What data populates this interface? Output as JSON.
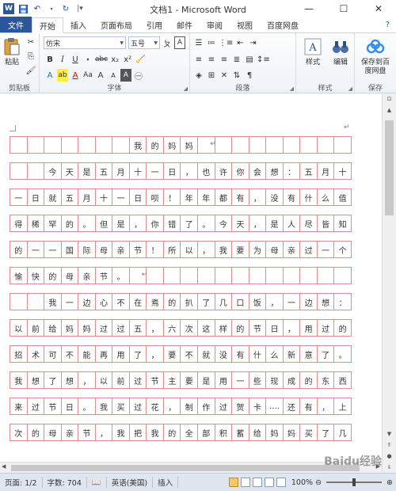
{
  "window": {
    "title": "文档1 - Microsoft Word",
    "controls": [
      "—",
      "☐",
      "✕"
    ]
  },
  "qat": {
    "undo": "↶",
    "redo": "↻"
  },
  "tabs": {
    "file": "文件",
    "items": [
      "开始",
      "插入",
      "页面布局",
      "引用",
      "邮件",
      "审阅",
      "视图",
      "百度网盘"
    ],
    "active": "开始",
    "help": "?"
  },
  "ribbon": {
    "clipboard": {
      "label": "剪贴板",
      "paste": "粘贴"
    },
    "font": {
      "label": "字体",
      "font_name": "仿宋",
      "font_size": "五号",
      "row1_buttons": [
        "A",
        "A",
        "Aa",
        "ab"
      ],
      "row2_buttons": [
        "B",
        "I",
        "U",
        "abc",
        "x₂",
        "x²"
      ],
      "row3_buttons": [
        "A",
        "A",
        "Aa",
        "A",
        "A"
      ]
    },
    "paragraph": {
      "label": "段落"
    },
    "styles": {
      "label": "样式",
      "button": "样式"
    },
    "editing": {
      "button": "编辑"
    },
    "save": {
      "label": "保存",
      "button_line1": "保存到百",
      "button_line2": "度网盘"
    }
  },
  "document": {
    "rows": [
      [
        "",
        "",
        "",
        "",
        "",
        "",
        "",
        "我",
        "的",
        "妈",
        "妈",
        "",
        "",
        "",
        "",
        "",
        "",
        "",
        "",
        ""
      ],
      [
        "",
        "",
        "今",
        "天",
        "是",
        "五",
        "月",
        "十",
        "一",
        "日",
        "，",
        "也",
        "许",
        "你",
        "会",
        "想",
        "：",
        "五",
        "月",
        "十"
      ],
      [
        "一",
        "日",
        "就",
        "五",
        "月",
        "十",
        "一",
        "日",
        "呗",
        "！",
        "年",
        "年",
        "都",
        "有",
        "，",
        "没",
        "有",
        "什",
        "么",
        "值"
      ],
      [
        "得",
        "稀",
        "罕",
        "的",
        "。",
        "但",
        "是",
        "，",
        "你",
        "错",
        "了",
        "。",
        "今",
        "天",
        "，",
        "是",
        "人",
        "尽",
        "皆",
        "知"
      ],
      [
        "的",
        "一",
        "一",
        "国",
        "际",
        "母",
        "亲",
        "节",
        "！",
        "所",
        "以",
        "，",
        "我",
        "要",
        "为",
        "母",
        "亲",
        "过",
        "一",
        "个"
      ],
      [
        "愉",
        "快",
        "的",
        "母",
        "亲",
        "节",
        "。",
        "",
        "",
        "",
        "",
        "",
        "",
        "",
        "",
        "",
        "",
        "",
        "",
        ""
      ],
      [
        "",
        "",
        "我",
        "一",
        "边",
        "心",
        "不",
        "在",
        "焉",
        "的",
        "扒",
        "了",
        "几",
        "口",
        "饭",
        "，",
        "一",
        "边",
        "想",
        "："
      ],
      [
        "以",
        "前",
        "给",
        "妈",
        "妈",
        "过",
        "过",
        "五",
        "，",
        "六",
        "次",
        "这",
        "样",
        "的",
        "节",
        "日",
        "，",
        "用",
        "过",
        "的"
      ],
      [
        "招",
        "术",
        "可",
        "不",
        "能",
        "再",
        "用",
        "了",
        "，",
        "要",
        "不",
        "就",
        "没",
        "有",
        "什",
        "么",
        "新",
        "意",
        "了",
        "。"
      ],
      [
        "我",
        "想",
        "了",
        "想",
        "，",
        "以",
        "前",
        "过",
        "节",
        "主",
        "要",
        "是",
        "用",
        "一",
        "些",
        "现",
        "成",
        "的",
        "东",
        "西"
      ],
      [
        "来",
        "过",
        "节",
        "日",
        "。",
        "我",
        "买",
        "过",
        "花",
        "，",
        "制",
        "作",
        "过",
        "贺",
        "卡",
        "….",
        "还",
        "有",
        "，",
        "上"
      ],
      [
        "次",
        "的",
        "母",
        "亲",
        "节",
        "，",
        "我",
        "把",
        "我",
        "的",
        "全",
        "部",
        "积",
        "蓄",
        "给",
        "妈",
        "妈",
        "买",
        "了",
        "几"
      ]
    ]
  },
  "statusbar": {
    "page": "页面: 1/2",
    "words": "字数: 704",
    "language": "英语(美国)",
    "mode": "插入",
    "zoom": "100%"
  },
  "watermark": "Baidu经验",
  "colors": {
    "file_tab": "#2b579a",
    "grid_line": "#e58a8a",
    "statusbar": "#dfe6f0"
  }
}
